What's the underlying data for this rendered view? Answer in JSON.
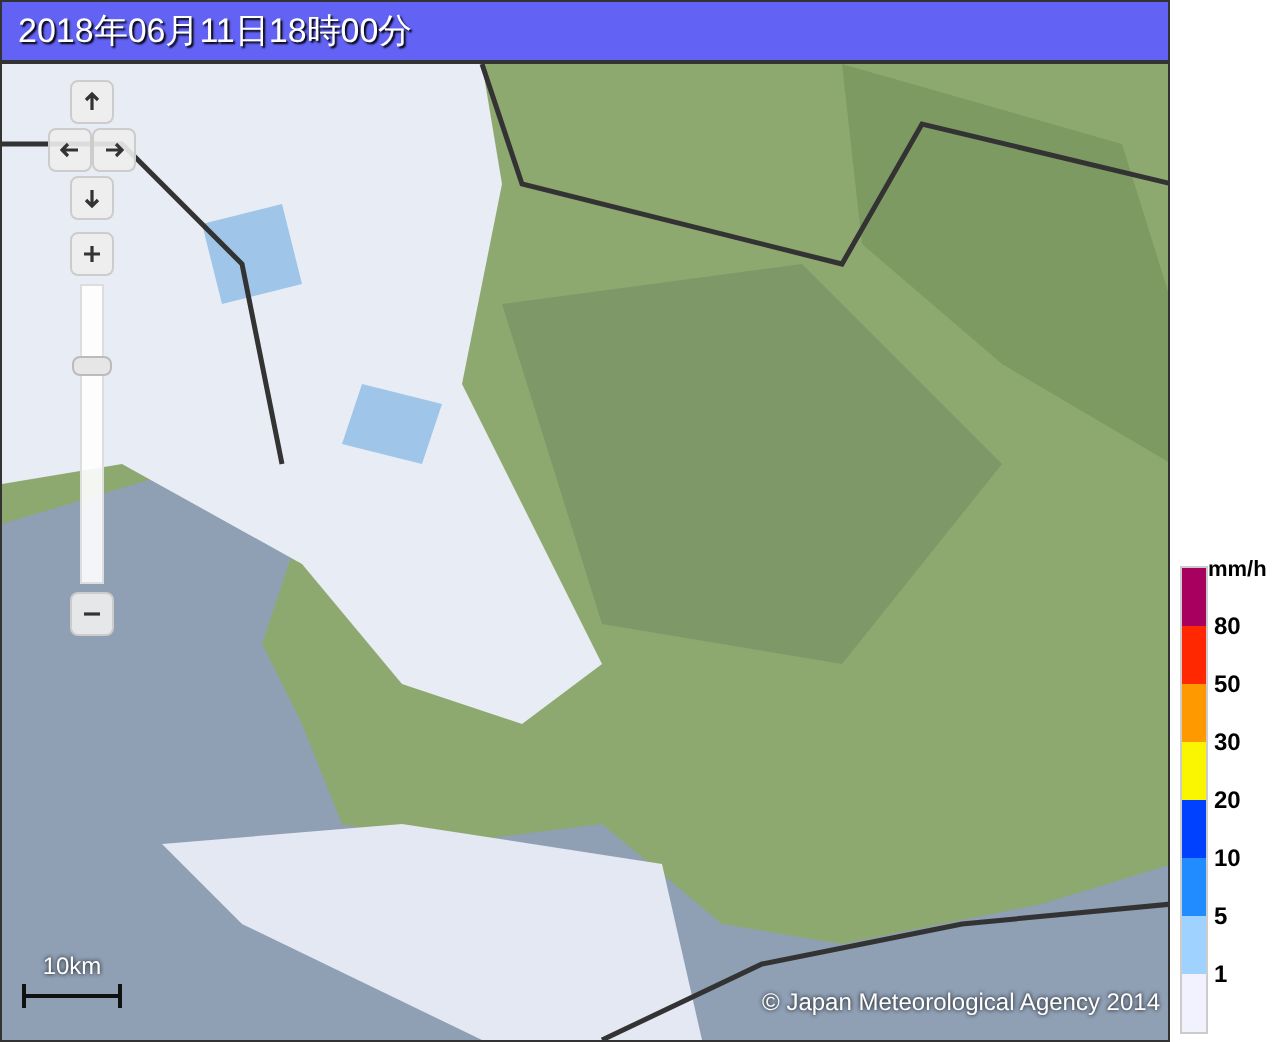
{
  "title": "2018年06月11日18時00分",
  "map": {
    "zoom_slider": {
      "level": 0.75
    },
    "scale": "10km",
    "copyright": "© Japan Meteorological Agency 2014"
  },
  "legend": {
    "unit": "mm/h",
    "swatches": [
      {
        "color": "#a8005f",
        "label": "80"
      },
      {
        "color": "#ff2800",
        "label": "50"
      },
      {
        "color": "#ff9900",
        "label": "30"
      },
      {
        "color": "#faf500",
        "label": "20"
      },
      {
        "color": "#0041ff",
        "label": "10"
      },
      {
        "color": "#218cff",
        "label": "5"
      },
      {
        "color": "#a0d2ff",
        "label": "1"
      },
      {
        "color": "#f2f2ff"
      }
    ]
  }
}
